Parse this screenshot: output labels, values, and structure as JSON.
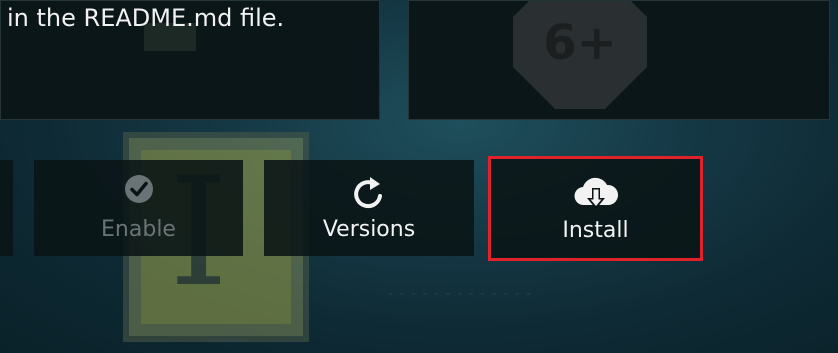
{
  "description": {
    "visible_text": "in the README.md file."
  },
  "rating_badge": {
    "text": "6+"
  },
  "actions": {
    "enable": {
      "label": "Enable",
      "icon": "checkmark-circle-icon",
      "state": "disabled"
    },
    "versions": {
      "label": "Versions",
      "icon": "refresh-icon"
    },
    "install": {
      "label": "Install",
      "icon": "cloud-download-icon",
      "highlighted": true
    }
  },
  "colors": {
    "highlight_border": "#e0222a",
    "button_bg": "#0a1416",
    "text_primary": "#f2f2f2",
    "text_disabled": "#6a7476"
  }
}
